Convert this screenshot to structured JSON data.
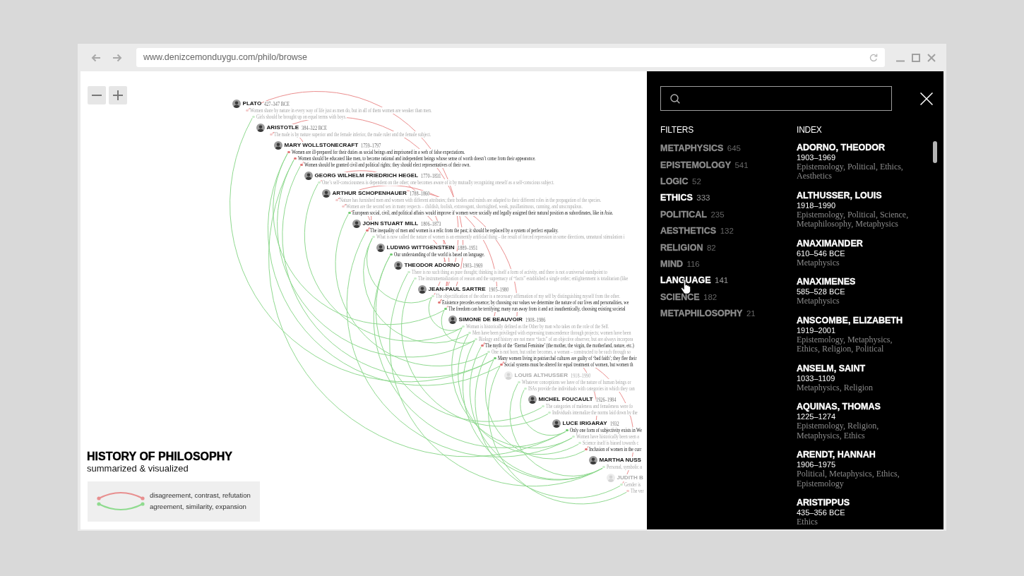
{
  "browser": {
    "url": "www.denizcemonduygu.com/philo/browse"
  },
  "thinkers": [
    {
      "name": "PLATO",
      "dates": "427–347 BCE",
      "dimmed": false,
      "quotes": [
        {
          "text": "Women share by nature in every way of life just as men do, but in all of them women are weaker than men.",
          "color": "#f4cbcb",
          "dimmed": true
        },
        {
          "text": "Girls should be brought up on equal terms with boys.",
          "color": "#cdeecd",
          "dimmed": true
        }
      ]
    },
    {
      "name": "ARISTOTLE",
      "dates": "384–322 BCE",
      "dimmed": false,
      "quotes": [
        {
          "text": "The male is by nature superior and the female inferior, the male ruler and the female subject.",
          "color": "#f4cbcb",
          "dimmed": true
        }
      ]
    },
    {
      "name": "MARY WOLLSTONECRAFT",
      "dates": "1759–1797",
      "dimmed": false,
      "quotes": [
        {
          "text": "Women are ill-prepared for their duties as social beings and imprisoned in a web of false expectations.",
          "color": "#e27676",
          "dimmed": false
        },
        {
          "text": "Women should be educated like men, to become rational and independent beings whose sense of worth doesn’t come from their appearance.",
          "color": "#e27676",
          "dimmed": false
        },
        {
          "text": "Women should be granted civil and political rights; they should elect representatives of their own.",
          "color": "#e27676",
          "dimmed": false
        }
      ]
    },
    {
      "name": "GEORG WILHELM FRIEDRICH HEGEL",
      "dates": "1770–1831",
      "dimmed": false,
      "quotes": [
        {
          "text": "One’s self-consciousness is dependent on the other; one becomes aware of it by mutually recognizing oneself as a self-conscious subject.",
          "color": "#cdeecd",
          "dimmed": true
        }
      ]
    },
    {
      "name": "ARTHUR SCHOPENHAUER",
      "dates": "1788–1860",
      "dimmed": false,
      "quotes": [
        {
          "text": "Nature has furnished men and women with different attributes; their bodies and minds are adapted to their different roles in the propagation of the species.",
          "color": "#f4cbcb",
          "dimmed": true
        },
        {
          "text": "Women are the second sex in many respects – childish, foolish, extravagant, shortsighted, weak, pusillanimous, cunning, and unscrupulous.",
          "color": "#f4cbcb",
          "dimmed": true
        },
        {
          "text": "European social, civil, and political affairs would improve if women were socially and legally assigned their natural position as subordinates, like in Asia.",
          "color": "#72cc72",
          "dimmed": false
        }
      ]
    },
    {
      "name": "JOHN STUART MILL",
      "dates": "1806–1873",
      "dimmed": false,
      "quotes": [
        {
          "text": "The inequality of men and women is a relic from the past; it should be replaced by a system of perfect equality.",
          "color": "#e27676",
          "dimmed": false
        },
        {
          "text": "What is now called the nature of women is an eminently artificial thing – the result of forced repression in some directions, unnatural stimulation i",
          "color": "#cdeecd",
          "dimmed": true
        }
      ]
    },
    {
      "name": "LUDWIG WITTGENSTEIN",
      "dates": "1889–1951",
      "dimmed": false,
      "quotes": [
        {
          "text": "Our understanding of the world is based on language.",
          "color": "#72cc72",
          "dimmed": false
        }
      ]
    },
    {
      "name": "THEODOR ADORNO",
      "dates": "1903–1969",
      "dimmed": false,
      "quotes": [
        {
          "text": "There is no such thing as pure thought; thinking is itself a form of activity, and there is not a universal standpoint to",
          "color": "#cdeecd",
          "dimmed": true
        },
        {
          "text": "The instrumentalization of reason and the supremacy of “facts” established a single order; enlightenment is totalitarian (like",
          "color": "#cdeecd",
          "dimmed": true
        }
      ]
    },
    {
      "name": "JEAN-PAUL SARTRE",
      "dates": "1905–1980",
      "dimmed": false,
      "quotes": [
        {
          "text": "The objectification of the other is a necessary affirmation of my self by distinguishing myself from the other.",
          "color": "#cdeecd",
          "dimmed": true
        },
        {
          "text": "Existence precedes essence; by choosing our values we determine the nature of our lives and personalities, we",
          "color": "#e27676",
          "dimmed": false
        },
        {
          "text": "The freedom can be terrifying; many run away from it and act inauthentically, choosing existing societal",
          "color": "#72cc72",
          "dimmed": false
        }
      ]
    },
    {
      "name": "SIMONE DE BEAUVOIR",
      "dates": "1908–1986",
      "dimmed": false,
      "quotes": [
        {
          "text": "Woman is historically defined as the Other by man who takes on the role of the Self.",
          "color": "#cdeecd",
          "dimmed": true
        },
        {
          "text": "Men have been privileged with expressing transcendence through projects; women have been",
          "color": "#cdeecd",
          "dimmed": true
        },
        {
          "text": "Biology and history are not mere “facts” of an objective observer, but are always incorpora",
          "color": "#cdeecd",
          "dimmed": true
        },
        {
          "text": "The myth of the ‘Eternal Feminine’ (the mother, the virgin, the motherland, nature, etc.)",
          "color": "#e27676",
          "dimmed": false
        },
        {
          "text": "One is not born, but rather becomes, a woman – constructed to be such through so",
          "color": "#cdeecd",
          "dimmed": true
        },
        {
          "text": "Many women living in patriarchal cultures are guilty of ‘bad faith’; they flee their",
          "color": "#72cc72",
          "dimmed": false
        },
        {
          "text": "Social systems must be altered for equal treatment of women, but women th",
          "color": "#e27676",
          "dimmed": false
        }
      ]
    },
    {
      "name": "LOUIS ALTHUSSER",
      "dates": "1918–1990",
      "dimmed": true,
      "quotes": [
        {
          "text": "Whatever conceptions we have of the nature of human beings or",
          "color": "#cdeecd",
          "dimmed": true
        },
        {
          "text": "ISAs provide the individuals with categories in which they can",
          "color": "#cdeecd",
          "dimmed": true
        }
      ]
    },
    {
      "name": "MICHEL FOUCAULT",
      "dates": "1926–1984",
      "dimmed": false,
      "quotes": [
        {
          "text": "The categories of maleness and femaleness were fo",
          "color": "#cdeecd",
          "dimmed": true
        },
        {
          "text": "Individuals internalize the norms laid down by the",
          "color": "#cdeecd",
          "dimmed": true
        }
      ]
    },
    {
      "name": "LUCE IRIGARAY",
      "dates": "1932",
      "dimmed": false,
      "quotes": [
        {
          "text": "Only one form of subjectivity exists in We",
          "color": "#72cc72",
          "dimmed": false
        },
        {
          "text": "Women have historically been seen a",
          "color": "#cdeecd",
          "dimmed": true
        },
        {
          "text": "Science itself is biased towards c",
          "color": "#cdeecd",
          "dimmed": true
        },
        {
          "text": "Inclusion of women in the curr",
          "color": "#e27676",
          "dimmed": false
        }
      ]
    },
    {
      "name": "MARTHA NUSS",
      "dimmed": false,
      "quotes": [
        {
          "text": "Personal, symbolic a",
          "color": "#cdeecd",
          "dimmed": true
        }
      ]
    },
    {
      "name": "JUDITH B",
      "dimmed": true,
      "quotes": [
        {
          "text": "Gender is",
          "color": "#cdeecd",
          "dimmed": true
        },
        {
          "text": "The ver",
          "color": "#f4cbcb",
          "dimmed": true
        }
      ]
    }
  ],
  "connections": [
    {
      "kind": "agreement"
    },
    {
      "kind": "agreement"
    },
    {
      "kind": "agreement"
    },
    {
      "kind": "agreement"
    },
    {
      "kind": "agreement"
    },
    {
      "kind": "agreement"
    },
    {
      "kind": "agreement"
    },
    {
      "kind": "agreement"
    },
    {
      "kind": "agreement"
    },
    {
      "kind": "agreement"
    },
    {
      "kind": "agreement"
    },
    {
      "kind": "agreement"
    },
    {
      "kind": "agreement"
    },
    {
      "kind": "agreement"
    },
    {
      "kind": "agreement"
    },
    {
      "kind": "agreement"
    },
    {
      "kind": "agreement"
    },
    {
      "kind": "agreement"
    },
    {
      "kind": "agreement"
    },
    {
      "kind": "agreement"
    },
    {
      "kind": "agreement"
    },
    {
      "kind": "agreement"
    },
    {
      "kind": "agreement"
    },
    {
      "kind": "agreement"
    },
    {
      "kind": "agreement"
    },
    {
      "kind": "agreement"
    },
    {
      "kind": "disagreement"
    },
    {
      "kind": "disagreement"
    },
    {
      "kind": "disagreement"
    },
    {
      "kind": "disagreement"
    },
    {
      "kind": "disagreement"
    },
    {
      "kind": "disagreement"
    },
    {
      "kind": "disagreement"
    },
    {
      "kind": "disagreement"
    },
    {
      "kind": "disagreement"
    },
    {
      "kind": "disagreement"
    },
    {
      "kind": "disagreement"
    },
    {
      "kind": "disagreement"
    }
  ],
  "title": "HISTORY OF PHILOSOPHY",
  "subtitle": "summarized & visualized",
  "legend": [
    {
      "kind": "disagreement",
      "label": "disagreement, contrast, refutation"
    },
    {
      "kind": "agreement",
      "label": "agreement, similarity, expansion"
    }
  ],
  "filters": {
    "heading": "FILTERS",
    "items": [
      {
        "label": "METAPHYSICS",
        "count": "645",
        "selected": false
      },
      {
        "label": "EPISTEMOLOGY",
        "count": "541",
        "selected": false
      },
      {
        "label": "LOGIC",
        "count": "52",
        "selected": false
      },
      {
        "label": "ETHICS",
        "count": "333",
        "selected": true
      },
      {
        "label": "POLITICAL",
        "count": "235",
        "selected": false
      },
      {
        "label": "AESTHETICS",
        "count": "132",
        "selected": false
      },
      {
        "label": "RELIGION",
        "count": "82",
        "selected": false
      },
      {
        "label": "MIND",
        "count": "116",
        "selected": false
      },
      {
        "label": "LANGUAGE",
        "count": "141",
        "selected": true
      },
      {
        "label": "SCIENCE",
        "count": "182",
        "selected": false
      },
      {
        "label": "METAPHILOSOPHY",
        "count": "21",
        "selected": false
      }
    ]
  },
  "index": {
    "heading": "INDEX",
    "entries": [
      {
        "name": "ADORNO, THEODOR",
        "dates": "1903–1969",
        "topics": "Epistemology, Political, Ethics, Aesthetics"
      },
      {
        "name": "ALTHUSSER, LOUIS",
        "dates": "1918–1990",
        "topics": "Epistemology, Political, Science, Metaphilosophy, Metaphysics"
      },
      {
        "name": "ANAXIMANDER",
        "dates": "610–546 BCE",
        "topics": "Metaphysics"
      },
      {
        "name": "ANAXIMENES",
        "dates": "585–528 BCE",
        "topics": "Metaphysics"
      },
      {
        "name": "ANSCOMBE, ELIZABETH",
        "dates": "1919–2001",
        "topics": "Epistemology, Metaphysics, Ethics, Religion, Political"
      },
      {
        "name": "ANSELM, SAINT",
        "dates": "1033–1109",
        "topics": "Metaphysics, Religion"
      },
      {
        "name": "AQUINAS, THOMAS",
        "dates": "1225–1274",
        "topics": "Epistemology, Religion, Metaphysics, Ethics"
      },
      {
        "name": "ARENDT, HANNAH",
        "dates": "1906–1975",
        "topics": "Political, Metaphysics, Ethics, Epistemology"
      },
      {
        "name": "ARISTIPPUS",
        "dates": "435–356 BCE",
        "topics": "Ethics"
      }
    ]
  }
}
